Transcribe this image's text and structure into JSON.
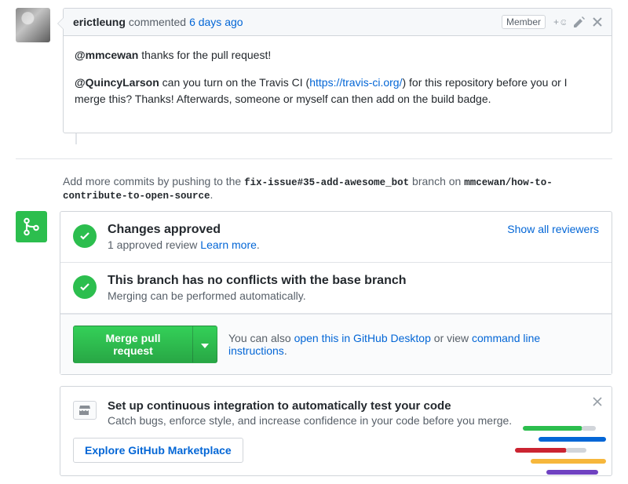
{
  "comment": {
    "author": "erictleung",
    "action": "commented",
    "time": "6 days ago",
    "badge": "Member",
    "body": {
      "p1_mention": "@mmcewan",
      "p1_rest": " thanks for the pull request!",
      "p2_mention": "@QuincyLarson",
      "p2_part1": " can you turn on the Travis CI (",
      "p2_link": "https://travis-ci.org/",
      "p2_part2": ") for this repository before you or I merge this? Thanks! Afterwards, someone or myself can then add on the build badge."
    }
  },
  "push_hint": {
    "prefix": "Add more commits by pushing to the ",
    "branch": "fix-issue#35-add-awesome_bot",
    "mid": " branch on ",
    "repo": "mmcewan/how-to-contribute-to-open-source",
    "suffix": "."
  },
  "status": {
    "approved_title": "Changes approved",
    "approved_sub_prefix": "1 approved review ",
    "approved_learn": "Learn more",
    "approved_sub_suffix": ".",
    "reviewers_link": "Show all reviewers",
    "conflict_title": "This branch has no conflicts with the base branch",
    "conflict_sub": "Merging can be performed automatically."
  },
  "merge": {
    "button": "Merge pull request",
    "hint_prefix": "You can also ",
    "desktop_link": "open this in GitHub Desktop",
    "hint_mid": " or view ",
    "cli_link": "command line instructions",
    "hint_suffix": "."
  },
  "ci": {
    "title": "Set up continuous integration to automatically test your code",
    "sub": "Catch bugs, enforce style, and increase confidence in your code before you merge.",
    "button": "Explore GitHub Marketplace"
  }
}
